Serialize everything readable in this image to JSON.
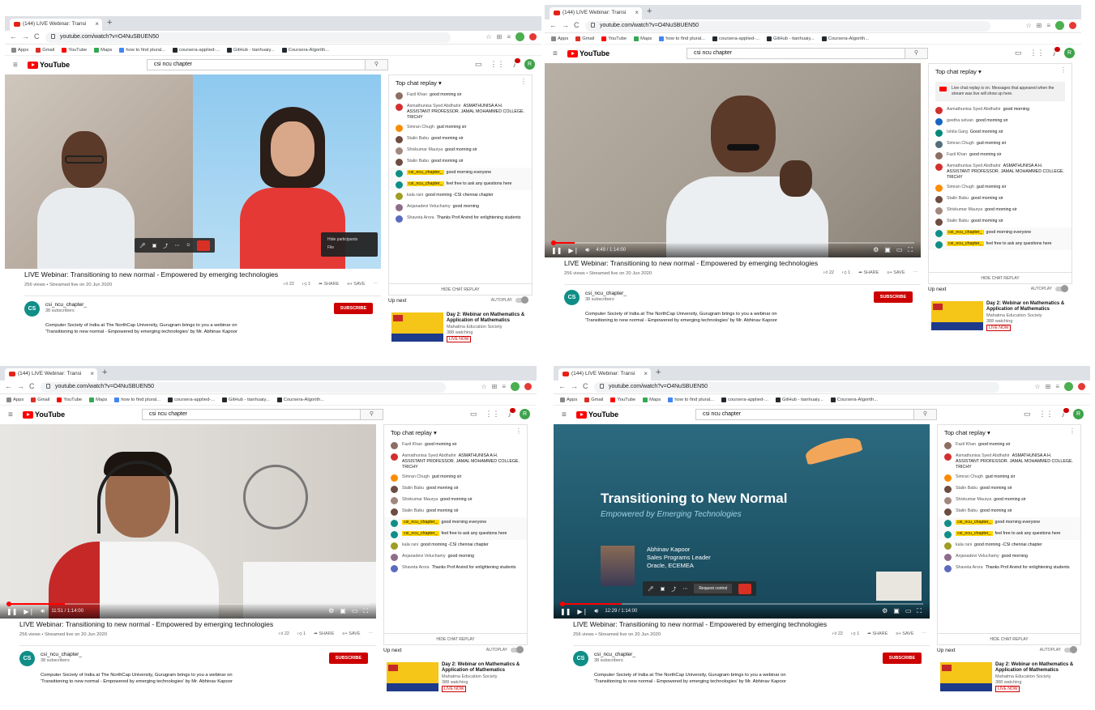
{
  "browser": {
    "tab_title": "(144) LIVE Webinar: Transi",
    "url": "youtube.com/watch?v=O4NuSBUEN50",
    "bookmarks": [
      "Apps",
      "Gmail",
      "YouTube",
      "Maps",
      "how to find plural...",
      "coursera-applied-...",
      "GitHub - tianhuaiy...",
      "Coursera-Algorith..."
    ],
    "profile_initial": "R"
  },
  "youtube": {
    "logo_text": "YouTube",
    "search_query": "csi ncu chapter",
    "avatar_initial": "R"
  },
  "video": {
    "title": "LIVE Webinar: Transitioning to new normal - Empowered by emerging technologies",
    "stats": "256 views • Streamed live on 20 Jun 2020",
    "likes": "22",
    "dislikes": "1",
    "share_label": "SHARE",
    "save_label": "SAVE"
  },
  "channel": {
    "avatar_initials": "CS",
    "name": "csi_ncu_chapter_",
    "subscribers": "38 subscribers",
    "subscribe_label": "SUBSCRIBE",
    "description_line1": "Computer Society of India at The NorthCap University, Gurugram brings to you a webinar on",
    "description_line2": "'Transitioning to new normal - Empowered by emerging technologies' by Mr. Abhinav Kapoor"
  },
  "chat": {
    "header": "Top chat replay",
    "notice": "Live chat replay is on. Messages that appeared when the stream was live will show up here.",
    "hide_label": "HIDE CHAT REPLAY",
    "messages_a": [
      {
        "author": "Fazil Khan",
        "text": "good morning sir",
        "color": "#8d6e63",
        "hl": false
      },
      {
        "author": "Asmathunisa Syed Abdhahir",
        "text": "ASMATHUNISA A H. ASSISTANT PROFESSOR. JAMAL MOHAMMED COLLEGE. TRICHY",
        "color": "#d32f2f",
        "hl": false
      },
      {
        "author": "Simran Chugh",
        "text": "gud morning sir",
        "color": "#fb8c00",
        "hl": false
      },
      {
        "author": "Stalin Babu",
        "text": "good morning sir",
        "color": "#6d4c41",
        "hl": false
      },
      {
        "author": "Shivkumar Maurya",
        "text": "good morning sir",
        "color": "#a1887f",
        "hl": false
      },
      {
        "author": "Stalin Babu",
        "text": "good morning sir",
        "color": "#6d4c41",
        "hl": false
      },
      {
        "author": "csi_ncu_chapter_",
        "text": "good morning everyone",
        "color": "#0f8e87",
        "hl": true
      },
      {
        "author": "csi_ncu_chapter_",
        "text": "feel free to ask any questions here",
        "color": "#0f8e87",
        "hl": true
      },
      {
        "author": "kala rani",
        "text": "good morning -CSI chennai chapter",
        "color": "#9e9d24",
        "hl": false
      },
      {
        "author": "Anjanadevi Veluchamy",
        "text": "good morning",
        "color": "#8e6c8a",
        "hl": false
      },
      {
        "author": "Shaveta Arora",
        "text": "Thanks Prof Arvind for enlightening students",
        "color": "#5c6bc0",
        "hl": false
      }
    ],
    "messages_b": [
      {
        "author": "Asmathunisa Syed Abdhahir",
        "text": "good morning",
        "color": "#d32f2f",
        "hl": false
      },
      {
        "author": "geetha selvan",
        "text": "good morning sir",
        "color": "#1565c0",
        "hl": false
      },
      {
        "author": "Ishita Garg",
        "text": "Good morning sir",
        "color": "#00897b",
        "hl": false
      },
      {
        "author": "Simran Chugh",
        "text": "gud morning sir",
        "color": "#546e7a",
        "hl": false
      },
      {
        "author": "Fazil Khan",
        "text": "good morning sir",
        "color": "#8d6e63",
        "hl": false
      },
      {
        "author": "Asmathunisa Syed Abdhahir",
        "text": "ASMATHUNISA A H. ASSISTANT PROFESSOR. JAMAL MOHAMMED COLLEGE. TRICHY",
        "color": "#d32f2f",
        "hl": false
      },
      {
        "author": "Simran Chugh",
        "text": "gud morning sir",
        "color": "#fb8c00",
        "hl": false
      },
      {
        "author": "Stalin Babu",
        "text": "good morning sir",
        "color": "#6d4c41",
        "hl": false
      },
      {
        "author": "Shivkumar Maurya",
        "text": "good morning sir",
        "color": "#a1887f",
        "hl": false
      },
      {
        "author": "Stalin Babu",
        "text": "good morning sir",
        "color": "#6d4c41",
        "hl": false
      },
      {
        "author": "csi_ncu_chapter_",
        "text": "good morning everyone",
        "color": "#0f8e87",
        "hl": true
      },
      {
        "author": "csi_ncu_chapter_",
        "text": "feel free to ask any questions here",
        "color": "#0f8e87",
        "hl": true
      }
    ]
  },
  "upnext": {
    "label": "Up next",
    "autoplay_label": "AUTOPLAY",
    "card_title": "Day 2: Webinar on Mathematics & Application of Mathematics",
    "card_channel": "Mahatma Education Society",
    "card_watching": "388 watching",
    "live_label": "LIVE NOW"
  },
  "panels": [
    {
      "time": "",
      "progress": 0.0,
      "scene": "two-person"
    },
    {
      "time": "4:49 / 1:14:00",
      "progress": 0.065,
      "scene": "speaker"
    },
    {
      "time": "11:51 / 1:14:00",
      "progress": 0.16,
      "scene": "headset"
    },
    {
      "time": "12:29 / 1:14:00",
      "progress": 0.17,
      "scene": "slide"
    }
  ],
  "zoom_controls": {
    "panel0_menu": [
      "Hide participants",
      "File"
    ],
    "request_control": "Request control"
  },
  "slide": {
    "title": "Transitioning to New Normal",
    "subtitle": "Empowered by Emerging Technologies",
    "speaker_name": "Abhinav Kapoor",
    "speaker_role": "Sales Programs Leader",
    "speaker_org": "Oracle, ECEMEA"
  },
  "colors": {
    "youtube_red": "#ff0000",
    "subscribe_red": "#cc0000",
    "highlight_yellow": "#ffd600",
    "channel_teal": "#0f8e87"
  }
}
